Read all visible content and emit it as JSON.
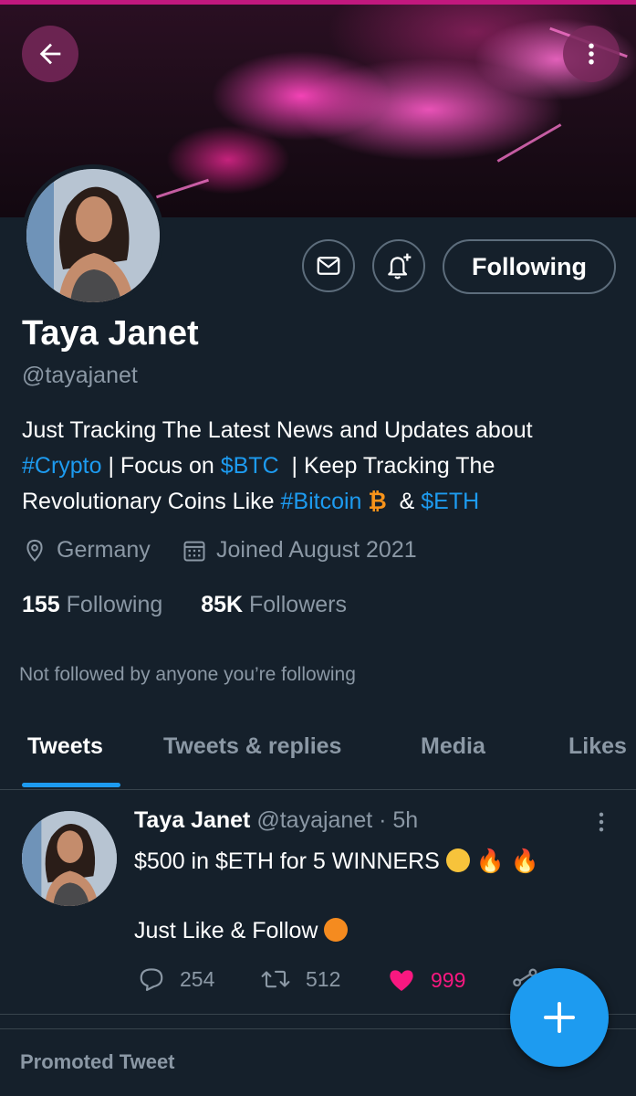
{
  "profile": {
    "name": "Taya Janet",
    "handle": "@tayajanet",
    "following_button": "Following",
    "bio": {
      "line1": "Just Tracking The Latest News and Updates about",
      "hashtag_crypto": "#Crypto",
      "focus_on": " | Focus on ",
      "cashtag_btc": "$BTC",
      "keep_tracking": "  | Keep Tracking The",
      "line3_start": "Revolutionary Coins Like ",
      "hashtag_bitcoin": "#Bitcoin",
      "bitcoin_symbol": "₿",
      "amp": "  & ",
      "cashtag_eth": "$ETH"
    },
    "location": "Germany",
    "joined": "Joined August 2021",
    "following_count": "155",
    "following_label": " Following",
    "followers_count": "85K",
    "followers_label": " Followers",
    "not_followed": "Not followed by anyone you’re following"
  },
  "tabs": [
    {
      "label": "Tweets",
      "active": true
    },
    {
      "label": "Tweets & replies",
      "active": false
    },
    {
      "label": "Media",
      "active": false
    },
    {
      "label": "Likes",
      "active": false
    }
  ],
  "tweet": {
    "author": "Taya Janet",
    "handle_time": " @tayajanet · 5h",
    "line1": "$500 in $ETH for 5 WINNERS ",
    "line2": "Just Like & Follow ",
    "replies": "254",
    "retweets": "512",
    "likes": "999",
    "liked": true
  },
  "promoted_label": "Promoted Tweet",
  "colors": {
    "background": "#15202b",
    "accent": "#1d9bf0",
    "like": "#f91880",
    "muted": "#8b98a5",
    "bitcoin": "#f7931a"
  },
  "icons": [
    "back-arrow-icon",
    "more-vertical-icon",
    "mail-icon",
    "bell-plus-icon",
    "location-pin-icon",
    "calendar-icon",
    "reply-icon",
    "retweet-icon",
    "heart-icon",
    "share-icon",
    "plus-icon"
  ]
}
